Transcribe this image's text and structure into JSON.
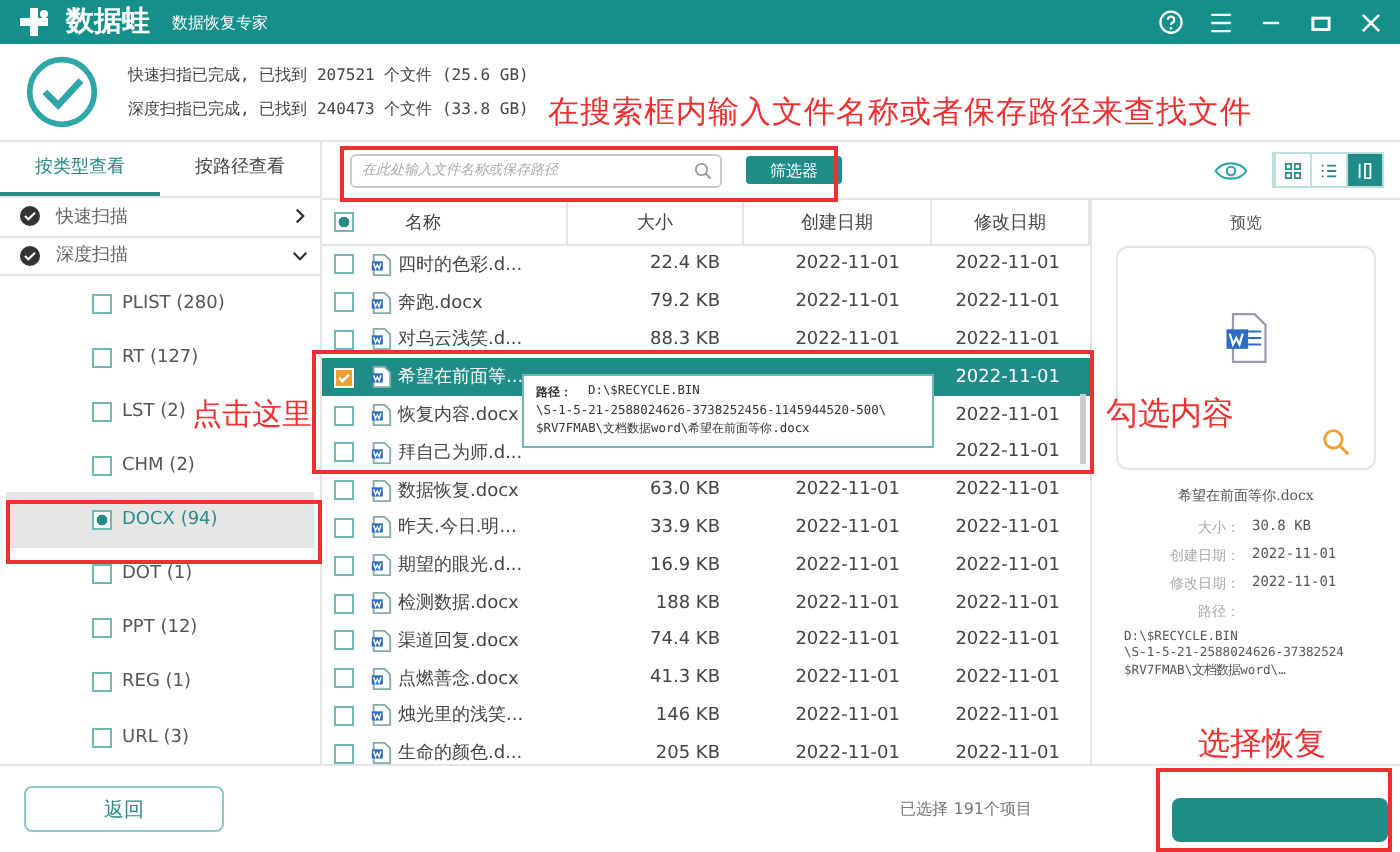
{
  "window": {
    "title": "数据蛙",
    "subtitle": "数据恢复专家"
  },
  "scan_summary": [
    "快速扫指已完成, 已找到 207521 个文件 (25.6 GB)",
    "深度扫指已完成, 已找到 240473 个文件 (33.8 GB)"
  ],
  "view_tabs": [
    {
      "label": "按类型查看",
      "selected": true
    },
    {
      "label": "按路径查看",
      "selected": false
    }
  ],
  "scans": [
    {
      "label": "快速扫描",
      "expanded": false
    },
    {
      "label": "深度扫描",
      "expanded": true,
      "children": [
        {
          "label": "PLIST (280)",
          "checked": false,
          "selected": false
        },
        {
          "label": "RT (127)",
          "checked": false,
          "selected": false
        },
        {
          "label": "LST (2)",
          "checked": false,
          "selected": false
        },
        {
          "label": "CHM (2)",
          "checked": false,
          "selected": false
        },
        {
          "label": "DOCX (94)",
          "checked": true,
          "selected": true
        },
        {
          "label": "DOT (1)",
          "checked": false,
          "selected": false
        },
        {
          "label": "PPT (12)",
          "checked": false,
          "selected": false
        },
        {
          "label": "REG (1)",
          "checked": false,
          "selected": false
        },
        {
          "label": "URL (3)",
          "checked": false,
          "selected": false
        }
      ]
    }
  ],
  "search": {
    "placeholder": "在此处输入文件名称或保存路径"
  },
  "filter_button": "筛选器",
  "view_modes": [
    {
      "kind": "grid",
      "selected": false
    },
    {
      "kind": "list",
      "selected": false
    },
    {
      "kind": "detail",
      "selected": true
    }
  ],
  "table": {
    "select_all_partial": true,
    "columns": [
      "名称",
      "大小",
      "创建日期",
      "修改日期"
    ],
    "rows": [
      {
        "name": "四时的色彩.d...",
        "size": "22.4 KB",
        "created": "2022-11-01",
        "modified": "2022-11-01",
        "checked": false,
        "selected": false
      },
      {
        "name": "奔跑.docx",
        "size": "79.2 KB",
        "created": "2022-11-01",
        "modified": "2022-11-01",
        "checked": false,
        "selected": false
      },
      {
        "name": "对乌云浅笑.d...",
        "size": "88.3 KB",
        "created": "2022-11-01",
        "modified": "2022-11-01",
        "checked": false,
        "selected": false
      },
      {
        "name": "希望在前面等...",
        "modified": "2022-11-01",
        "checked": true,
        "selected": true
      },
      {
        "name": "恢复内容.docx",
        "modified": "2022-11-01",
        "checked": false,
        "selected": false
      },
      {
        "name": "拜自己为师.d...",
        "modified": "2022-11-01",
        "checked": false,
        "selected": false
      },
      {
        "name": "数据恢复.docx",
        "size": "63.0 KB",
        "created": "2022-11-01",
        "modified": "2022-11-01",
        "checked": false,
        "selected": false
      },
      {
        "name": "昨天.今日.明...",
        "size": "33.9 KB",
        "created": "2022-11-01",
        "modified": "2022-11-01",
        "checked": false,
        "selected": false
      },
      {
        "name": "期望的眼光.d...",
        "size": "16.9 KB",
        "created": "2022-11-01",
        "modified": "2022-11-01",
        "checked": false,
        "selected": false
      },
      {
        "name": "检测数据.docx",
        "size": "188 KB",
        "created": "2022-11-01",
        "modified": "2022-11-01",
        "checked": false,
        "selected": false
      },
      {
        "name": "渠道回复.docx",
        "size": "74.4 KB",
        "created": "2022-11-01",
        "modified": "2022-11-01",
        "checked": false,
        "selected": false
      },
      {
        "name": "点燃善念.docx",
        "size": "41.3 KB",
        "created": "2022-11-01",
        "modified": "2022-11-01",
        "checked": false,
        "selected": false
      },
      {
        "name": "烛光里的浅笑...",
        "size": "146 KB",
        "created": "2022-11-01",
        "modified": "2022-11-01",
        "checked": false,
        "selected": false
      },
      {
        "name": "生命的颜色.d...",
        "size": "205 KB",
        "created": "2022-11-01",
        "modified": "2022-11-01",
        "checked": false,
        "selected": false
      }
    ]
  },
  "tooltip": {
    "label": "路径：",
    "lines": [
      "D:\\$RECYCLE.BIN",
      "\\S-1-5-21-2588024626-3738252456-1145944520-500\\",
      "$RV7FMAB\\文档数据word\\希望在前面等你.docx"
    ]
  },
  "preview": {
    "title": "预览",
    "file_name": "希望在前面等你.docx",
    "fields": [
      {
        "label": "大小：",
        "value": "30.8 KB"
      },
      {
        "label": "创建日期：",
        "value": "2022-11-01"
      },
      {
        "label": "修改日期：",
        "value": "2022-11-01"
      }
    ],
    "path_label": "路径：",
    "path_lines": [
      "D:\\$RECYCLE.BIN",
      "\\S-1-5-21-2588024626-37382524",
      "$RV7FMAB\\文档数据word\\…"
    ]
  },
  "footer": {
    "back_button": "返回",
    "status": "已选择 191个项目"
  },
  "annotations": [
    {
      "kind": "search",
      "text": "在搜索框内输入文件名称或者保存路径来查找文件"
    },
    {
      "kind": "click",
      "text": "点击这里"
    },
    {
      "kind": "check",
      "text": "勾选内容"
    },
    {
      "kind": "recover",
      "text": "选择恢复"
    }
  ]
}
